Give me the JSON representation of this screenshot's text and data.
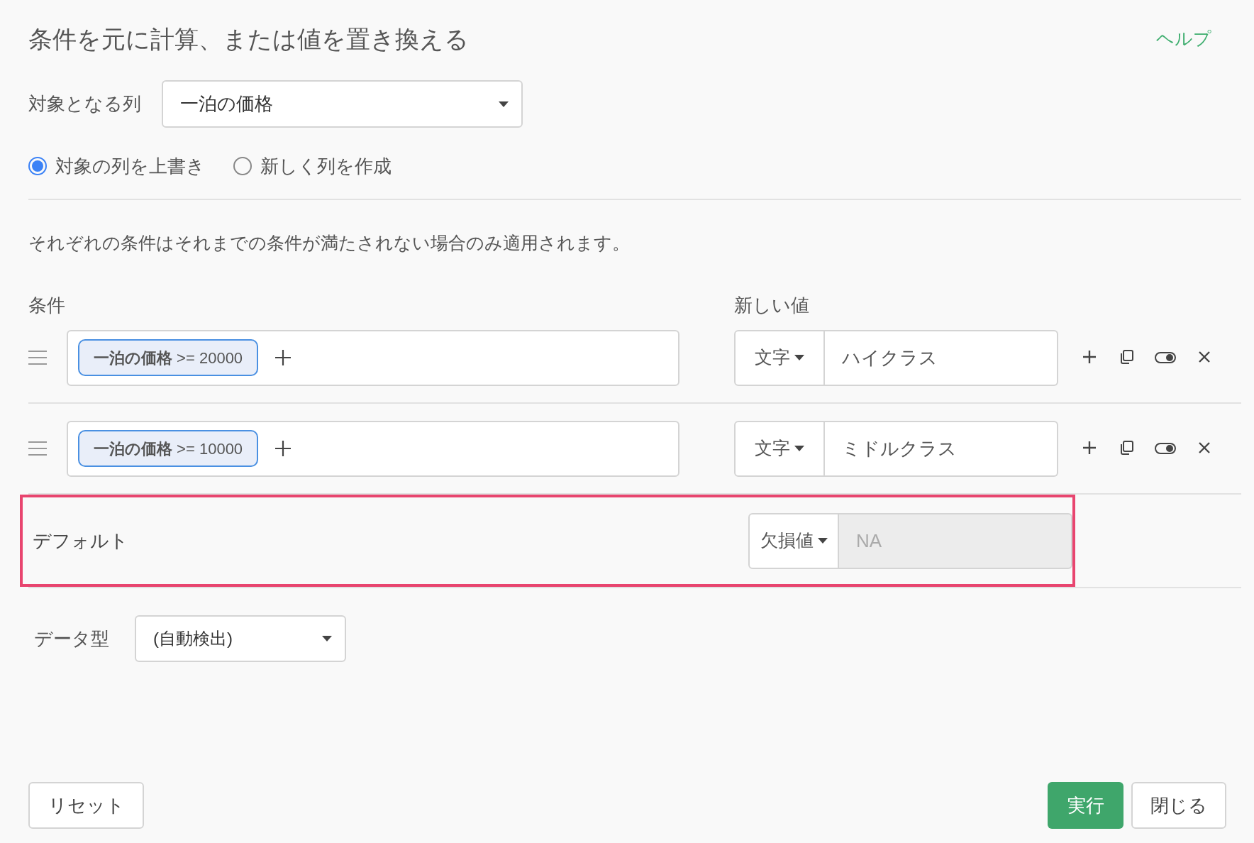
{
  "title": "条件を元に計算、または値を置き換える",
  "help_link": "ヘルプ",
  "target_column": {
    "label": "対象となる列",
    "value": "一泊の価格"
  },
  "output_mode": [
    {
      "label": "対象の列を上書き",
      "selected": true
    },
    {
      "label": "新しく列を作成",
      "selected": false
    }
  ],
  "notice": "それぞれの条件はそれまでの条件が満たされない場合のみ適用されます。",
  "headers": {
    "conditions": "条件",
    "new_value": "新しい値"
  },
  "rules": [
    {
      "condition": "**一泊の価格** >= 20000",
      "value_type": "文字",
      "value": "ハイクラス"
    },
    {
      "condition": "**一泊の価格** >= 10000",
      "value_type": "文字",
      "value": "ミドルクラス"
    }
  ],
  "default": {
    "label": "デフォルト",
    "value_type": "欠損値",
    "value": "NA",
    "disabled": true,
    "highlighted": true
  },
  "data_type": {
    "label": "データ型",
    "value": "(自動検出)"
  },
  "buttons": {
    "reset": "リセット",
    "run": "実行",
    "close": "閉じる"
  }
}
